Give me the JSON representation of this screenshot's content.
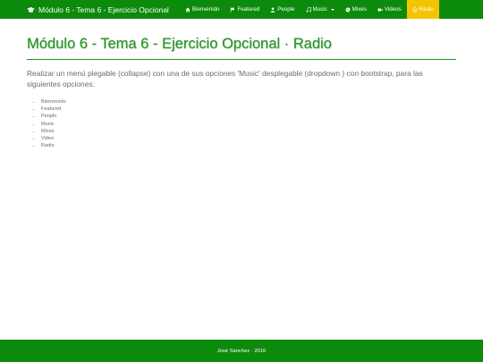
{
  "navbar": {
    "brand": "Módulo 6 - Tema 6 - Ejercicio Opcional",
    "brand_icon": "graduation-cap-icon",
    "items": [
      {
        "label": "Bienvenido",
        "icon": "home-icon"
      },
      {
        "label": "Featured",
        "icon": "flag-icon"
      },
      {
        "label": "People",
        "icon": "user-icon"
      },
      {
        "label": "Music",
        "icon": "music-icon",
        "dropdown": true
      },
      {
        "label": "Mixes",
        "icon": "globe-icon"
      },
      {
        "label": "Videos",
        "icon": "video-icon"
      },
      {
        "label": "Radio",
        "icon": "radio-icon",
        "active": true
      }
    ]
  },
  "main": {
    "title": "Módulo 6 - Tema 6 - Ejercicio Opcional · Radio",
    "description": "Realizar un menú plegable (collapse) con una de sus opciones 'Music' desplegable (dropdown ) con bootstrap, para las siguientes opciones:",
    "options": [
      "Bienvenido",
      "Featured",
      "People",
      "Music",
      "Mixes",
      "Video",
      "Radio"
    ]
  },
  "footer": {
    "text": "José Sánchez · 2016"
  },
  "colors": {
    "nav_bg": "#0c8a0c",
    "active_bg": "#f5c400",
    "title": "#1b9a1b"
  }
}
